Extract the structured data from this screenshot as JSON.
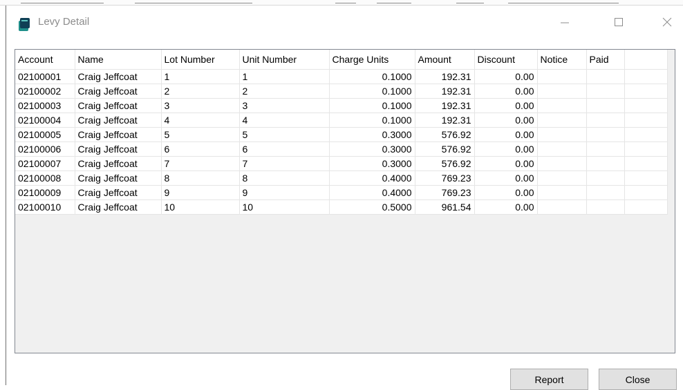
{
  "window": {
    "title": "Levy Detail"
  },
  "table": {
    "columns": [
      "Account",
      "Name",
      "Lot Number",
      "Unit Number",
      "Charge Units",
      "Amount",
      "Discount",
      "Notice",
      "Paid"
    ],
    "rows": [
      [
        "02100001",
        "Craig Jeffcoat",
        "1",
        "1",
        "0.1000",
        "192.31",
        "0.00",
        "",
        ""
      ],
      [
        "02100002",
        "Craig Jeffcoat",
        "2",
        "2",
        "0.1000",
        "192.31",
        "0.00",
        "",
        ""
      ],
      [
        "02100003",
        "Craig Jeffcoat",
        "3",
        "3",
        "0.1000",
        "192.31",
        "0.00",
        "",
        ""
      ],
      [
        "02100004",
        "Craig Jeffcoat",
        "4",
        "4",
        "0.1000",
        "192.31",
        "0.00",
        "",
        ""
      ],
      [
        "02100005",
        "Craig Jeffcoat",
        "5",
        "5",
        "0.3000",
        "576.92",
        "0.00",
        "",
        ""
      ],
      [
        "02100006",
        "Craig Jeffcoat",
        "6",
        "6",
        "0.3000",
        "576.92",
        "0.00",
        "",
        ""
      ],
      [
        "02100007",
        "Craig Jeffcoat",
        "7",
        "7",
        "0.3000",
        "576.92",
        "0.00",
        "",
        ""
      ],
      [
        "02100008",
        "Craig Jeffcoat",
        "8",
        "8",
        "0.4000",
        "769.23",
        "0.00",
        "",
        ""
      ],
      [
        "02100009",
        "Craig Jeffcoat",
        "9",
        "9",
        "0.4000",
        "769.23",
        "0.00",
        "",
        ""
      ],
      [
        "02100010",
        "Craig Jeffcoat",
        "10",
        "10",
        "0.5000",
        "961.54",
        "0.00",
        "",
        ""
      ]
    ]
  },
  "buttons": {
    "report": "Report",
    "close": "Close"
  },
  "icons": {
    "app": "app-icon",
    "minimize": "minimize-icon",
    "maximize": "maximize-icon",
    "close": "close-icon"
  }
}
